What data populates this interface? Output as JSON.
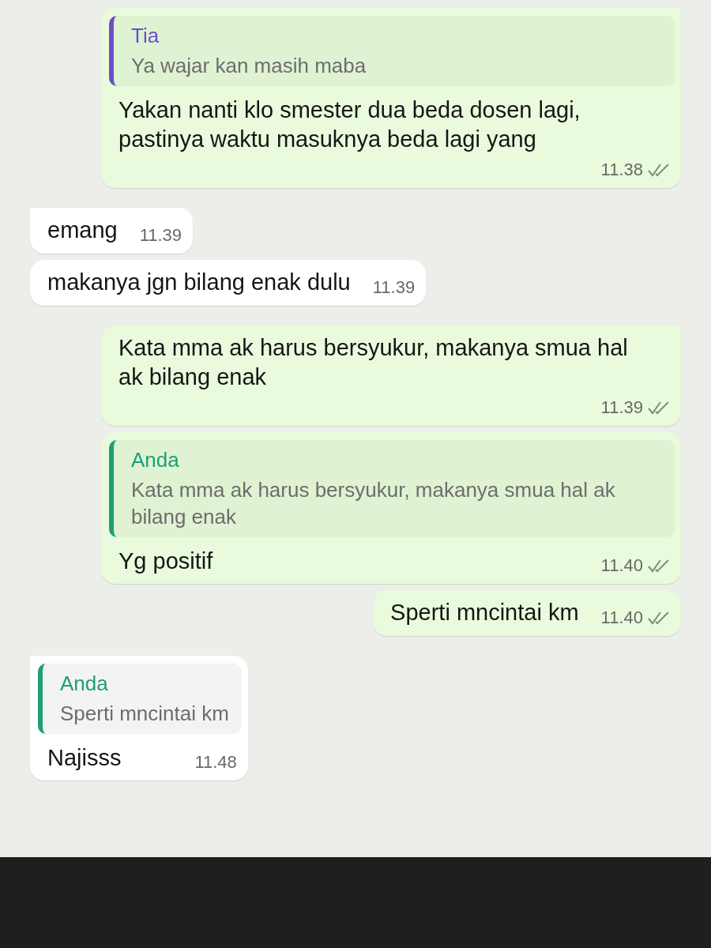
{
  "messages": [
    {
      "kind": "out",
      "tail": true,
      "quote": {
        "author": "Tia",
        "color": "#6b4fcb",
        "text": "Ya wajar kan masih maba"
      },
      "text": "Yakan nanti klo smester dua beda dosen lagi, pastinya waktu masuknya beda lagi yang",
      "time": "11.38"
    },
    {
      "kind": "in",
      "tail": true,
      "text": "emang",
      "time": "11.39"
    },
    {
      "kind": "in",
      "tail": false,
      "text": "makanya jgn bilang enak dulu",
      "time": "11.39"
    },
    {
      "kind": "out",
      "tail": true,
      "text": "Kata mma ak harus bersyukur, makanya smua hal ak bilang enak",
      "time": "11.39"
    },
    {
      "kind": "out",
      "tail": false,
      "quote": {
        "author": "Anda",
        "color": "#1f9e76",
        "text": "Kata mma ak harus bersyukur, makanya smua hal ak bilang enak"
      },
      "text": "Yg positif",
      "time": "11.40"
    },
    {
      "kind": "out",
      "tail": false,
      "text": "Sperti mncintai km",
      "time": "11.40"
    },
    {
      "kind": "in",
      "tail": true,
      "quote": {
        "author": "Anda",
        "color": "#1f9e76",
        "text": "Sperti mncintai km"
      },
      "text": "Najisss",
      "time": "11.48"
    }
  ]
}
